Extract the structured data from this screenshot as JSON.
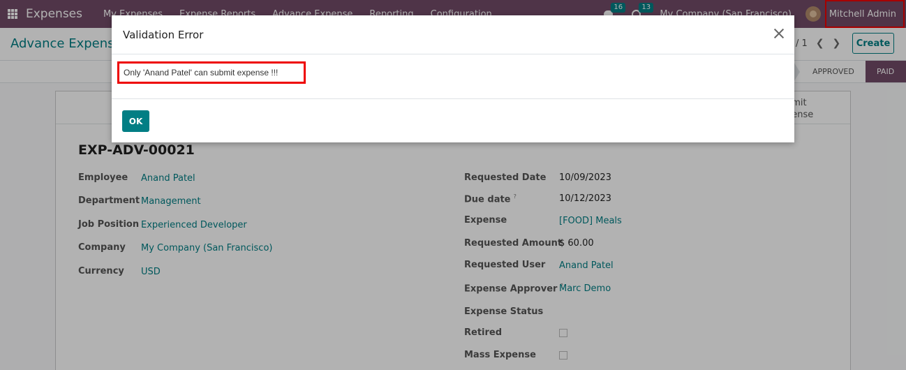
{
  "navbar": {
    "app_name": "Expenses",
    "menu": [
      "My Expenses",
      "Expense Reports",
      "Advance Expense",
      "Reporting",
      "Configuration"
    ],
    "chat_count": "16",
    "activity_count": "13",
    "company": "My Company (San Francisco)",
    "user": "Mitchell Admin"
  },
  "control": {
    "breadcrumb": "Advance Expense",
    "pager": "/ 1",
    "create_label": "Create"
  },
  "statusbar": {
    "stages": [
      "APPROVED",
      "PAID"
    ],
    "active_stage": "PAID"
  },
  "sheet": {
    "smart_button_line1": "bmit",
    "smart_button_line2": "pense",
    "title": "EXP-ADV-00021",
    "left_fields": [
      {
        "label": "Employee",
        "value": "Anand Patel"
      },
      {
        "label": "Department",
        "value": "Management"
      },
      {
        "label": "Job Position",
        "value": "Experienced Developer"
      },
      {
        "label": "Company",
        "value": "My Company (San Francisco)"
      },
      {
        "label": "Currency",
        "value": "USD"
      }
    ],
    "right_fields": [
      {
        "label": "Requested Date",
        "value": "10/09/2023"
      },
      {
        "label": "Due date",
        "value": "10/12/2023",
        "help": "?"
      },
      {
        "label": "Expense",
        "value": "[FOOD] Meals"
      },
      {
        "label": "Requested Amount",
        "value": "$ 60.00"
      },
      {
        "label": "Requested User",
        "value": "Anand Patel"
      },
      {
        "label": "Expense Approver",
        "value": "Marc Demo",
        "help": "?"
      },
      {
        "label": "Expense Status",
        "value": ""
      },
      {
        "label": "Retired",
        "value": ""
      },
      {
        "label": "Mass Expense",
        "value": ""
      }
    ]
  },
  "dialog": {
    "title": "Validation Error",
    "message": "Only 'Anand Patel' can submit expense !!!",
    "ok_label": "OK"
  },
  "colors": {
    "brand": "#714b67",
    "accent": "#017e84",
    "highlight": "#e00000"
  }
}
